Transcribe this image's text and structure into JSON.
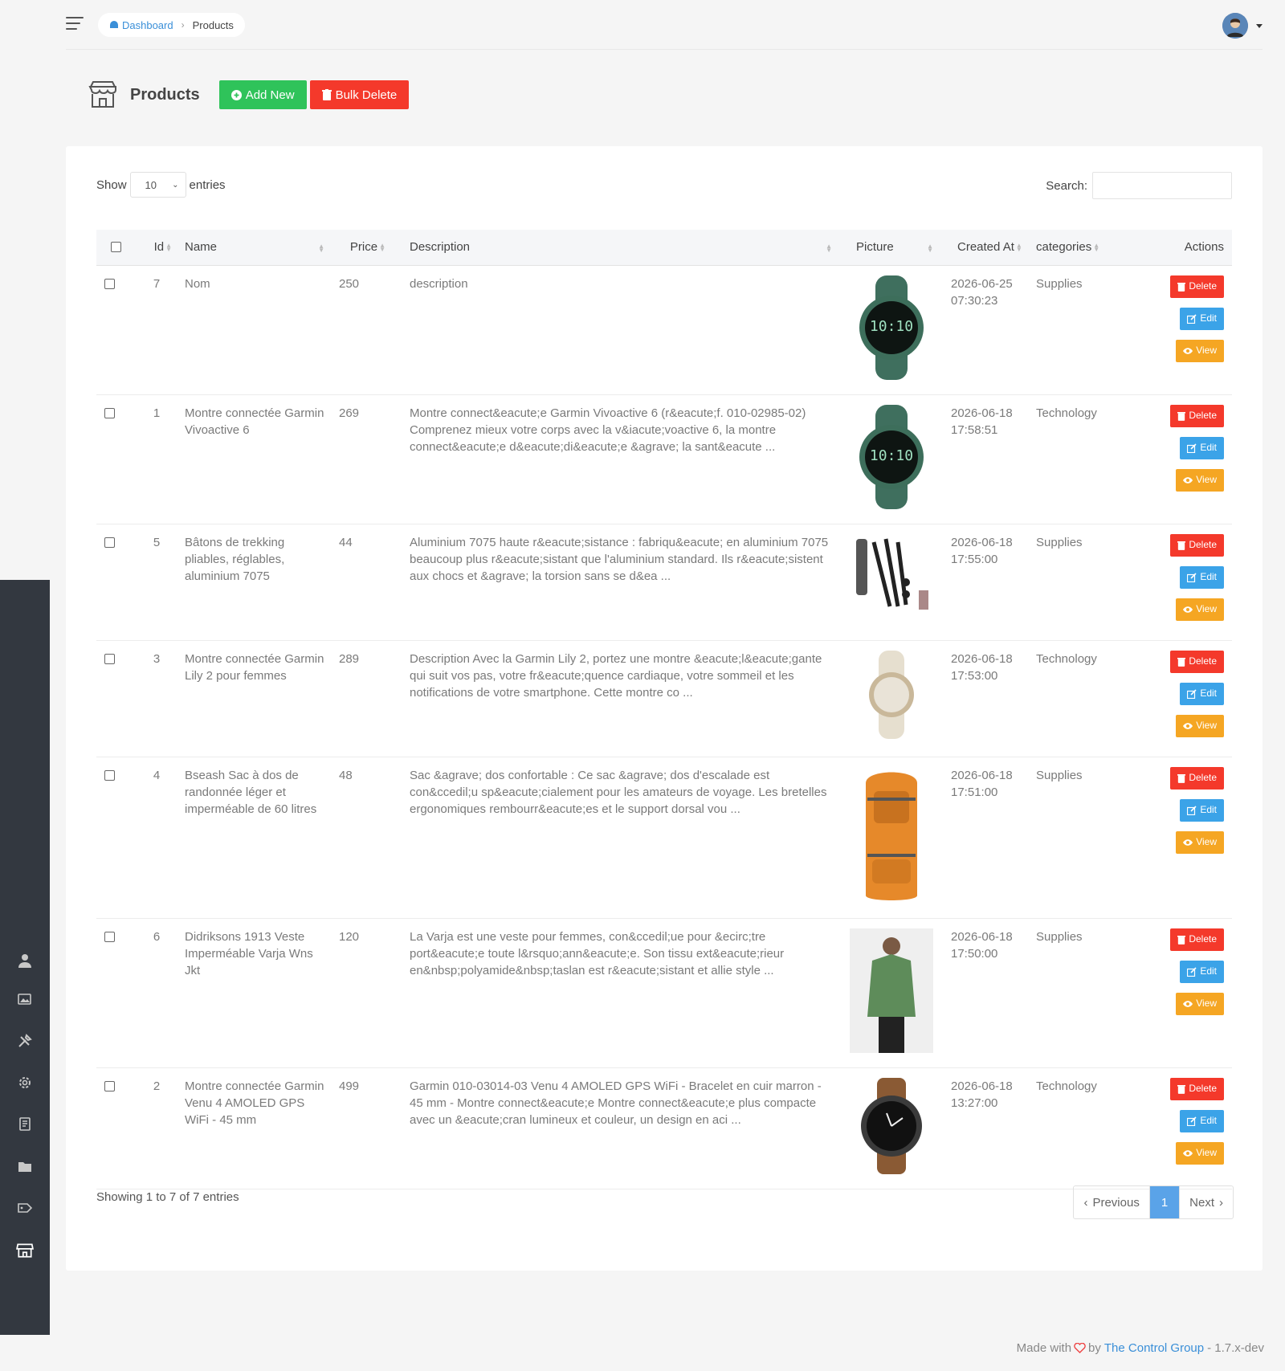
{
  "breadcrumb": {
    "home": "Dashboard",
    "current": "Products"
  },
  "page": {
    "title": "Products",
    "add_label": "Add New",
    "bulk_label": "Bulk Delete"
  },
  "length": {
    "show": "Show",
    "value": "10",
    "entries": "entries"
  },
  "search": {
    "label": "Search:",
    "placeholder": ""
  },
  "columns": {
    "id": "Id",
    "name": "Name",
    "price": "Price",
    "description": "Description",
    "picture": "Picture",
    "created": "Created At",
    "categories": "categories",
    "actions": "Actions"
  },
  "rows": [
    {
      "id": "7",
      "name": "Nom",
      "price": "250",
      "description": "description",
      "created_date": "2026-06-25",
      "created_time": "07:30:23",
      "category": "Supplies",
      "picture": "green-smartwatch"
    },
    {
      "id": "1",
      "name": "Montre connectée Garmin Vivoactive 6",
      "price": "269",
      "description": "Montre connect&eacute;e Garmin Vivoactive 6 (r&eacute;f. 010-02985-02) Comprenez mieux votre corps avec la v&iacute;voactive 6, la montre connect&eacute;e d&eacute;di&eacute;e &agrave; la sant&eacute ...",
      "created_date": "2026-06-18",
      "created_time": "17:58:51",
      "category": "Technology",
      "picture": "green-smartwatch"
    },
    {
      "id": "5",
      "name": "Bâtons de trekking pliables, réglables, aluminium 7075",
      "price": "44",
      "description": "Aluminium 7075 haute r&eacute;sistance : fabriqu&eacute; en aluminium 7075 beaucoup plus r&eacute;sistant que l'aluminium standard. Ils r&eacute;sistent aux chocs et &agrave; la torsion sans se d&ea ...",
      "created_date": "2026-06-18",
      "created_time": "17:55:00",
      "category": "Supplies",
      "picture": "trekking-poles"
    },
    {
      "id": "3",
      "name": "Montre connectée Garmin Lily 2 pour femmes",
      "price": "289",
      "description": "Description Avec la Garmin Lily 2, portez une montre &eacute;l&eacute;gante qui suit vos pas, votre fr&eacute;quence cardiaque, votre sommeil et les notifications de votre smartphone. Cette montre co ...",
      "created_date": "2026-06-18",
      "created_time": "17:53:00",
      "category": "Technology",
      "picture": "cream-watch"
    },
    {
      "id": "4",
      "name": "Bseash Sac à dos de randonnée léger et imperméable de 60 litres",
      "price": "48",
      "description": "Sac &agrave; dos confortable : Ce sac &agrave; dos d'escalade est con&ccedil;u sp&eacute;cialement pour les amateurs de voyage. Les bretelles ergonomiques rembourr&eacute;es et le support dorsal vou ...",
      "created_date": "2026-06-18",
      "created_time": "17:51:00",
      "category": "Supplies",
      "picture": "orange-backpack"
    },
    {
      "id": "6",
      "name": "Didriksons 1913 Veste Imperméable Varja Wns Jkt",
      "price": "120",
      "description": "La Varja est une veste pour femmes, con&ccedil;ue pour &ecirc;tre port&eacute;e toute l&rsquo;ann&eacute;e. Son tissu ext&eacute;rieur en&nbsp;polyamide&nbsp;taslan est r&eacute;sistant et allie style ...",
      "created_date": "2026-06-18",
      "created_time": "17:50:00",
      "category": "Supplies",
      "picture": "green-jacket"
    },
    {
      "id": "2",
      "name": "Montre connectée Garmin Venu 4 AMOLED GPS WiFi - 45 mm",
      "price": "499",
      "description": "Garmin 010-03014-03 Venu 4 AMOLED GPS WiFi - Bracelet en cuir marron - 45 mm - Montre connect&eacute;e Montre connect&eacute;e plus compacte avec un &eacute;cran lumineux et couleur, un design en aci ...",
      "created_date": "2026-06-18",
      "created_time": "13:27:00",
      "category": "Technology",
      "picture": "brown-watch"
    }
  ],
  "row_actions": {
    "delete": "Delete",
    "edit": "Edit",
    "view": "View"
  },
  "info": "Showing 1 to 7 of 7 entries",
  "pagination": {
    "previous": "Previous",
    "current": "1",
    "next": "Next"
  },
  "footer": {
    "made_with": "Made with",
    "by": "by",
    "company": "The Control Group",
    "version": "- 1.7.x-dev"
  },
  "colors": {
    "add": "#2fc35a",
    "delete": "#f4392b",
    "edit": "#3ba3e8",
    "view": "#f5a623",
    "sidebar": "#333840",
    "link": "#3a8fd8"
  }
}
